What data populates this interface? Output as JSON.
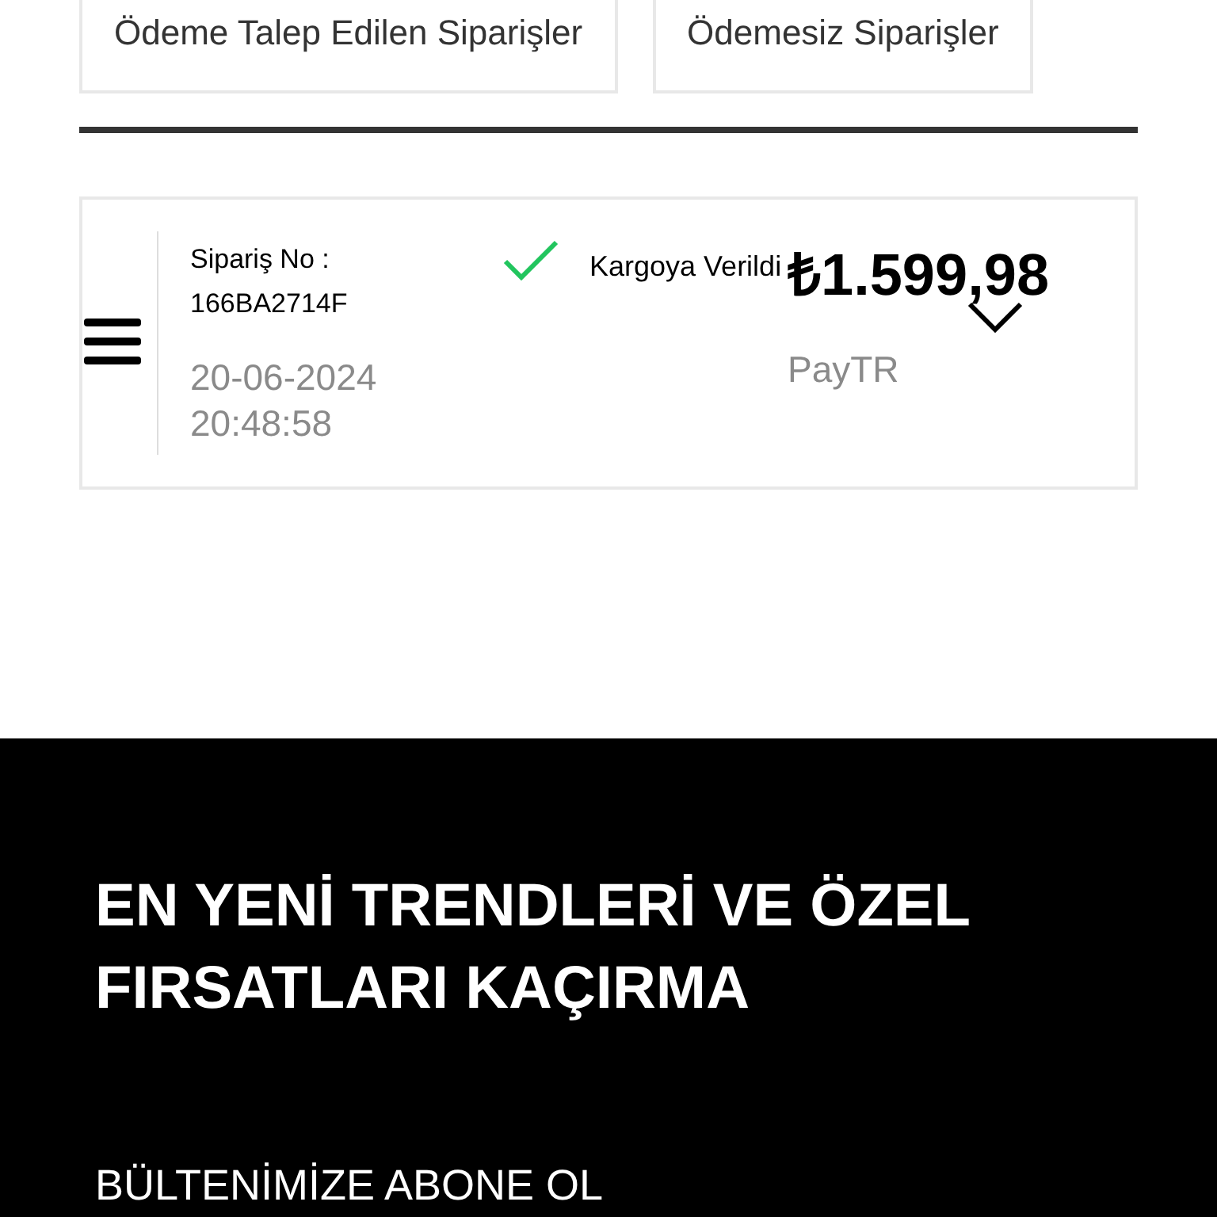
{
  "order_filters": [
    {
      "label": "Ödeme Talep Edilen Siparişler"
    },
    {
      "label": "Ödemesiz Siparişler"
    }
  ],
  "order": {
    "number_label": "Sipariş No :",
    "number": "166BA2714F",
    "date": "20-06-2024",
    "time": "20:48:58",
    "status": "Kargoya Verildi",
    "delivered": true,
    "total": "₺1.599,98",
    "payment_method": "PayTR",
    "expanded": false
  },
  "newsletter": {
    "heading": "EN YENİ TRENDLERİ VE ÖZEL FIRSATLARI KAÇIRMA",
    "subheading": "BÜLTENİMİZE ABONE OL"
  }
}
